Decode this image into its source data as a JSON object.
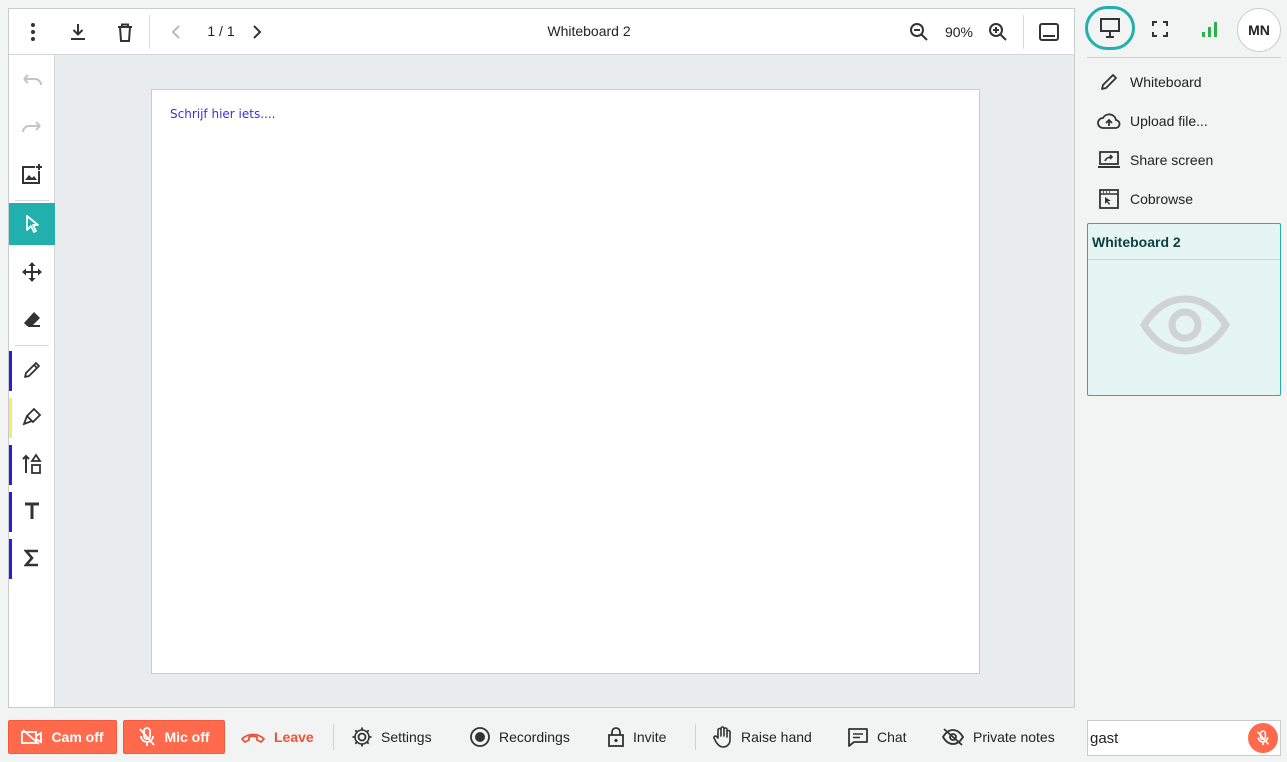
{
  "toolbar": {
    "page_indicator": "1 / 1",
    "title": "Whiteboard 2",
    "zoom": "90%"
  },
  "canvas": {
    "text": "Schrijf hier iets...."
  },
  "right_panel": {
    "avatar_initials": "MN",
    "menu": [
      {
        "label": "Whiteboard",
        "icon": "pencil-icon"
      },
      {
        "label": "Upload file...",
        "icon": "cloud-upload-icon"
      },
      {
        "label": "Share screen",
        "icon": "share-screen-icon"
      },
      {
        "label": "Cobrowse",
        "icon": "cobrowse-icon"
      }
    ],
    "card_title": "Whiteboard 2"
  },
  "bottom": {
    "cam": "Cam off",
    "mic": "Mic off",
    "leave": "Leave",
    "settings": "Settings",
    "recordings": "Recordings",
    "invite": "Invite",
    "raise_hand": "Raise hand",
    "chat": "Chat",
    "private_notes": "Private notes"
  },
  "name_field": {
    "value": "gast"
  },
  "colors": {
    "accent": "#21b0ad",
    "danger": "#ff6a4d",
    "pen_color": "#2a1fd6",
    "highlighter_color": "#f2ee6b"
  }
}
